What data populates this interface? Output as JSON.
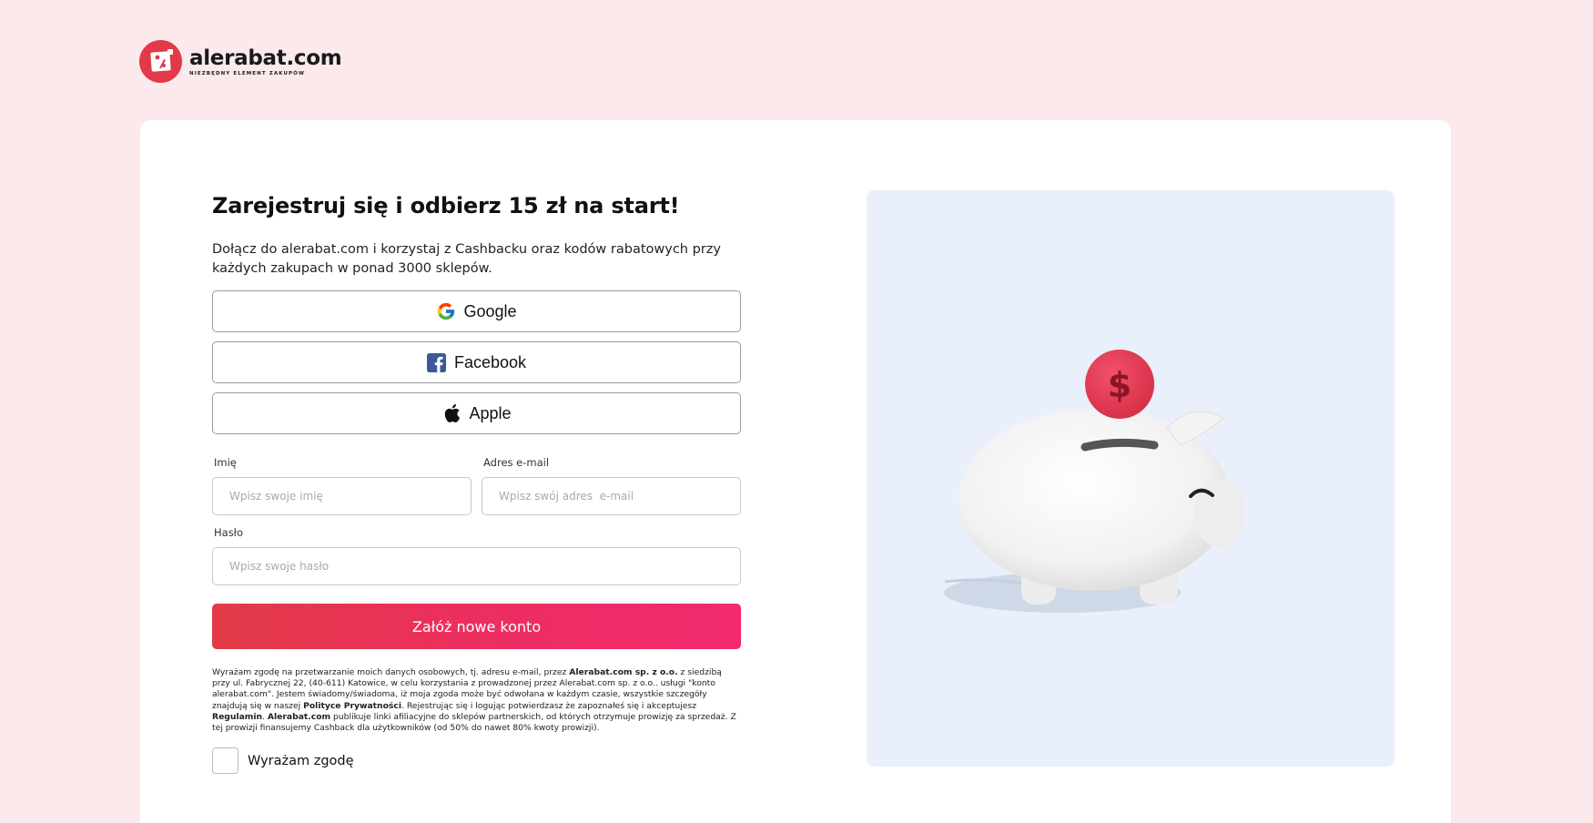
{
  "brand": {
    "name": "alerabat.com",
    "tagline": "NIEZBĘDNY ELEMENT ZAKUPÓW",
    "accent_color": "#e23a4a"
  },
  "signup": {
    "title": "Zarejestruj się i odbierz 15 zł na start!",
    "subtitle": "Dołącz do alerabat.com i korzystaj z Cashbacku oraz kodów rabatowych przy każdych zakupach w ponad 3000 sklepów.",
    "social": [
      {
        "label": "Google",
        "icon": "google-icon"
      },
      {
        "label": "Facebook",
        "icon": "facebook-icon"
      },
      {
        "label": "Apple",
        "icon": "apple-icon"
      }
    ],
    "fields": {
      "name": {
        "label": "Imię",
        "placeholder": "Wpisz swoje imię",
        "value": ""
      },
      "email": {
        "label": "Adres e-mail",
        "placeholder": "Wpisz swój adres  e-mail",
        "value": ""
      },
      "password": {
        "label": "Hasło",
        "placeholder": "Wpisz swoje hasło",
        "value": ""
      }
    },
    "submit_label": "Załóż nowe konto",
    "legal": {
      "p1": "Wyrażam zgodę na przetwarzanie moich danych osobowych, tj. adresu e-mail, przez ",
      "company": "Alerabat.com sp. z o.o.",
      "p2": " z siedzibą przy ul. Fabrycznej 22, (40-611) Katowice, w celu korzystania z prowadzonej przez Alerabat.com sp. z o.o.. usługi \"konto alerabat.com\". Jestem świadomy/świadoma, iż moja zgoda może być odwołana w każdym czasie, wszystkie szczegóły znajdują się w naszej ",
      "privacy": "Polityce Prywatności",
      "p3": ". Rejestrując się i logując potwierdzasz że zapoznałeś się i akceptujesz ",
      "terms": "Regulamin",
      "p4": ". ",
      "company2": "Alerabat.com",
      "p5": " publikuje linki afiliacyjne do sklepów partnerskich, od których otrzymuje prowizję za sprzedaż. Z tej prowizji finansujemy Cashback dla użytkowników (od 50% do nawet 80% kwoty prowizji)."
    },
    "consent_label": "Wyrażam zgodę",
    "consent_checked": false
  },
  "illustration": {
    "icon": "piggy-bank-icon",
    "coin_symbol": "$",
    "coin_color": "#e8394f"
  }
}
